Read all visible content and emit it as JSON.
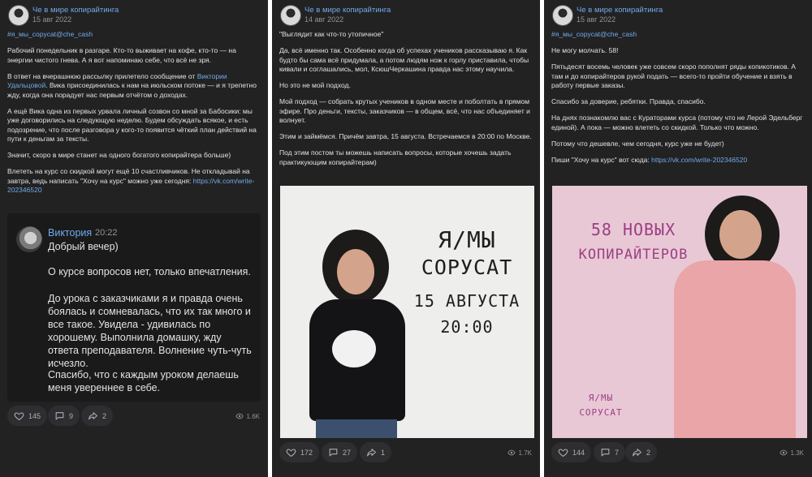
{
  "posts": [
    {
      "group_name": "Че в мире копирайтинга",
      "date": "15 авг 2022",
      "hashtag": "#я_мы_copycat@che_cash",
      "paragraphs": {
        "p1": "Рабочий понедельник в разгаре. Кто-то выживает на кофе, кто-то — на энергии чистого гнева. А я вот напоминаю себе, что всё не зря.",
        "p2_before": "В ответ на вчерашнюю рассылку прилетело сообщение от ",
        "p2_link": "Виктории Удальцовой",
        "p2_after": ". Вика присоединилась к нам на июльском потоке — и я трепетно жду, когда она порадует нас первым отчётом о доходах.",
        "p3": "А ещё Вика одна из первых урвала личный созвон со мной за Бабосики: мы уже договорились на следующую неделю. Будем обсуждать всякое, и есть подозрение, что после разговора у кого-то появится чёткий план действий на пути к деньгам за тексты.",
        "p4": "Значит, скоро в мире станет на одного богатого копирайтера больше)",
        "p5_before": "Влететь на курс со скидкой могут ещё 10 счастливчиков. Не откладывай на завтра, ведь написать \"Хочу на курс\" можно уже сегодня: ",
        "p5_link": "https://vk.com/write-202346520"
      },
      "screenshot": {
        "name": "Виктория",
        "time": "20:22",
        "m1": "Добрый вечер)",
        "m2": "О курсе вопросов нет, только впечатления.",
        "m3": "До урока с заказчиками я и правда очень боялась и сомневалась, что их так много и все такое. Увидела - удивилась по хорошему. Выполнила домашку, жду ответа преподавателя. Волнение чуть-чуть исчезло.",
        "m4": "Спасибо, что с каждым уроком делаешь меня увереннее в себе."
      },
      "likes": "145",
      "comments": "9",
      "shares": "2",
      "views": "1.6K"
    },
    {
      "group_name": "Че в мире копирайтинга",
      "date": "14 авг 2022",
      "paragraphs": {
        "p1": "\"Выглядит как что-то утопичное\"",
        "p2": "Да, всё именно так. Особенно когда об успехах учеников рассказываю я. Как будто бы сама всё придумала, а потом людям нож к горлу приставила, чтобы кивали и соглашались, мол, КсюшЧеркашина правда нас этому научила.",
        "p3": "Но это не мой подход.",
        "p4": "Мой подход — собрать крутых учеников в одном месте и поболтать в прямом эфире. Про деньги, тексты, заказчиков — в общем, всё, что нас объединяет и волнует.",
        "p5": "Этим и займёмся. Причём завтра, 15 августа. Встречаемся в 20:00 по Москве.",
        "p6": "Под этим постом ты можешь написать вопросы, которые хочешь задать практикующим копирайтерам)"
      },
      "image_text": {
        "line1": "Я/МЫ",
        "line2": "СОРУСАТ",
        "line3": "15 АВГУСТА",
        "line4": "20:00"
      },
      "likes": "172",
      "comments": "27",
      "shares": "1",
      "views": "1.7K"
    },
    {
      "group_name": "Че в мире копирайтинга",
      "date": "15 авг 2022",
      "hashtag": "#я_мы_copycat@che_cash",
      "paragraphs": {
        "p1": "Не могу молчать. 58!",
        "p2": "Пятьдесят восемь человек уже совсем скоро пополнят ряды копикотиков. А там и до копирайтеров рукой подать — всего-то пройти обучение и взять в работу первые заказы.",
        "p3": "Спасибо за доверие, ребятки. Правда, спасибо.",
        "p4": "На днях познакомлю вас с Кураторами курса (потому что не Лерой Эдельберг единой). А пока — можно влететь со скидкой. Только что можно.",
        "p5": "Потому что дешевле, чем сегодня, курс уже не будет)",
        "p6_before": "Пиши \"Хочу на курс\" вот сюда: ",
        "p6_link": "https://vk.com/write-202346520"
      },
      "image_text": {
        "line1": "58 НОВЫХ",
        "line2": "КОПИРАЙТЕРОВ",
        "line3": "Я/МЫ",
        "line4": "СОРУСАТ"
      },
      "likes": "144",
      "comments": "7",
      "shares": "2",
      "views": "1.3K"
    }
  ],
  "colors": {
    "background": "#222222",
    "link": "#71aaeb",
    "text": "#e1e3e6",
    "muted": "#8f949a",
    "button": "#2e2e30"
  },
  "icons": [
    "heart-icon",
    "comment-icon",
    "share-icon",
    "eye-icon"
  ]
}
